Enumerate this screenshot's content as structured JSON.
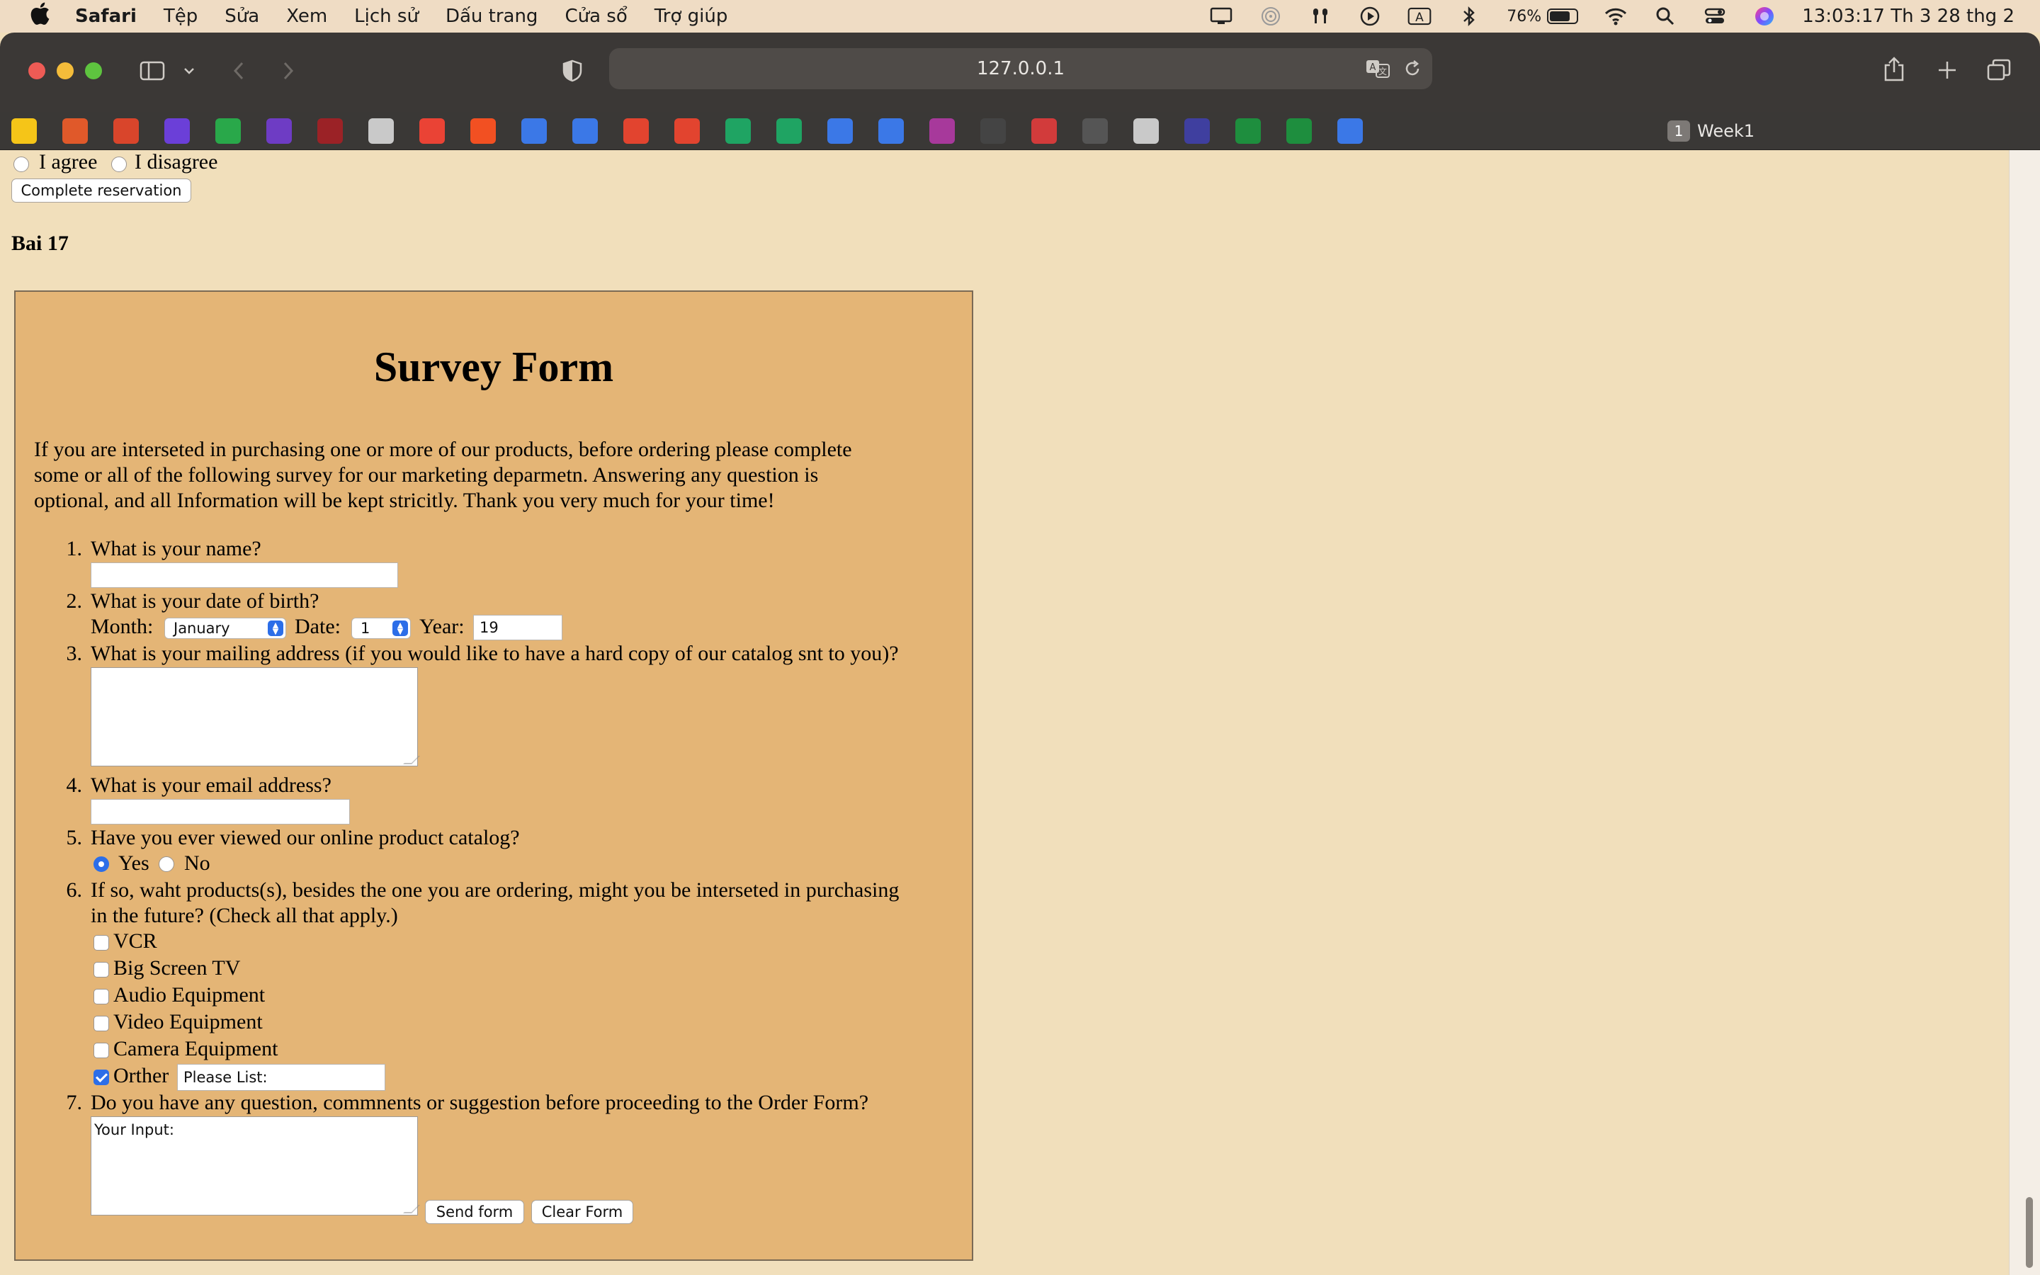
{
  "menubar": {
    "app": "Safari",
    "items": [
      "Tệp",
      "Sửa",
      "Xem",
      "Lịch sử",
      "Dấu trang",
      "Cửa sổ",
      "Trợ giúp"
    ],
    "battery_percent": "76%",
    "battery_level": 0.76,
    "clock": "13:03:17 Th 3 28 thg 2"
  },
  "browser": {
    "url": "127.0.0.1",
    "tab_group_count": "1",
    "tab_group_name": "Week1",
    "bookmark_colors": [
      "#f5c518",
      "#e0592a",
      "#d9452b",
      "#6b3fd8",
      "#29a84a",
      "#6e3cc4",
      "#9b2226",
      "#c9c9c9",
      "#ea4335",
      "#f25022",
      "#3b78e7",
      "#3b78e7",
      "#e2442f",
      "#e2442f",
      "#1fa463",
      "#1fa463",
      "#3b78e7",
      "#3b78e7",
      "#a7399b",
      "#444444",
      "#d23b3b",
      "#555555",
      "#c9c9c9",
      "#3f3f9f",
      "#1e8e3e",
      "#1e8e3e",
      "#3b78e7"
    ]
  },
  "page": {
    "agree_label": "I agree",
    "disagree_label": "I disagree",
    "complete_button": "Complete reservation",
    "section_heading": "Bai 17"
  },
  "survey": {
    "title": "Survey Form",
    "intro_line1": "If you are interseted in purchasing one or more of our products, before ordering please complete",
    "intro_line2": "some or all of the following survey for our marketing deparmetn. Answering any question is",
    "intro_line3": "optional, and all Information will be kept stricitly. Thank you very much for your time!",
    "q1": "What is your name?",
    "q2": "What is your date of birth?",
    "month_label": "Month:",
    "month_value": "January",
    "date_label": "Date:",
    "date_value": "1",
    "year_label": "Year:",
    "year_value": "19",
    "q3": "What is your mailing address (if you would like to have a hard copy of our catalog snt to you)?",
    "q4": "What is your email address?",
    "q5": "Have you ever viewed our online product catalog?",
    "yes_label": "Yes",
    "no_label": "No",
    "q6_line1": "If so, waht products(s), besides the one you are ordering, might you be interseted in purchasing",
    "q6_line2": "in the future? (Check all that apply.)",
    "products": [
      "VCR",
      "Big Screen TV",
      "Audio Equipment",
      "Video Equipment",
      "Camera Equipment"
    ],
    "other_label": "Orther",
    "other_value": "Please List:",
    "q7": "Do you have any question, commnents or suggestion before proceeding to the Order Form?",
    "comment_value": "Your Input:",
    "send_button": "Send form",
    "clear_button": "Clear Form",
    "numbers": [
      "1.",
      "2.",
      "3.",
      "4.",
      "5.",
      "6.",
      "7."
    ]
  }
}
